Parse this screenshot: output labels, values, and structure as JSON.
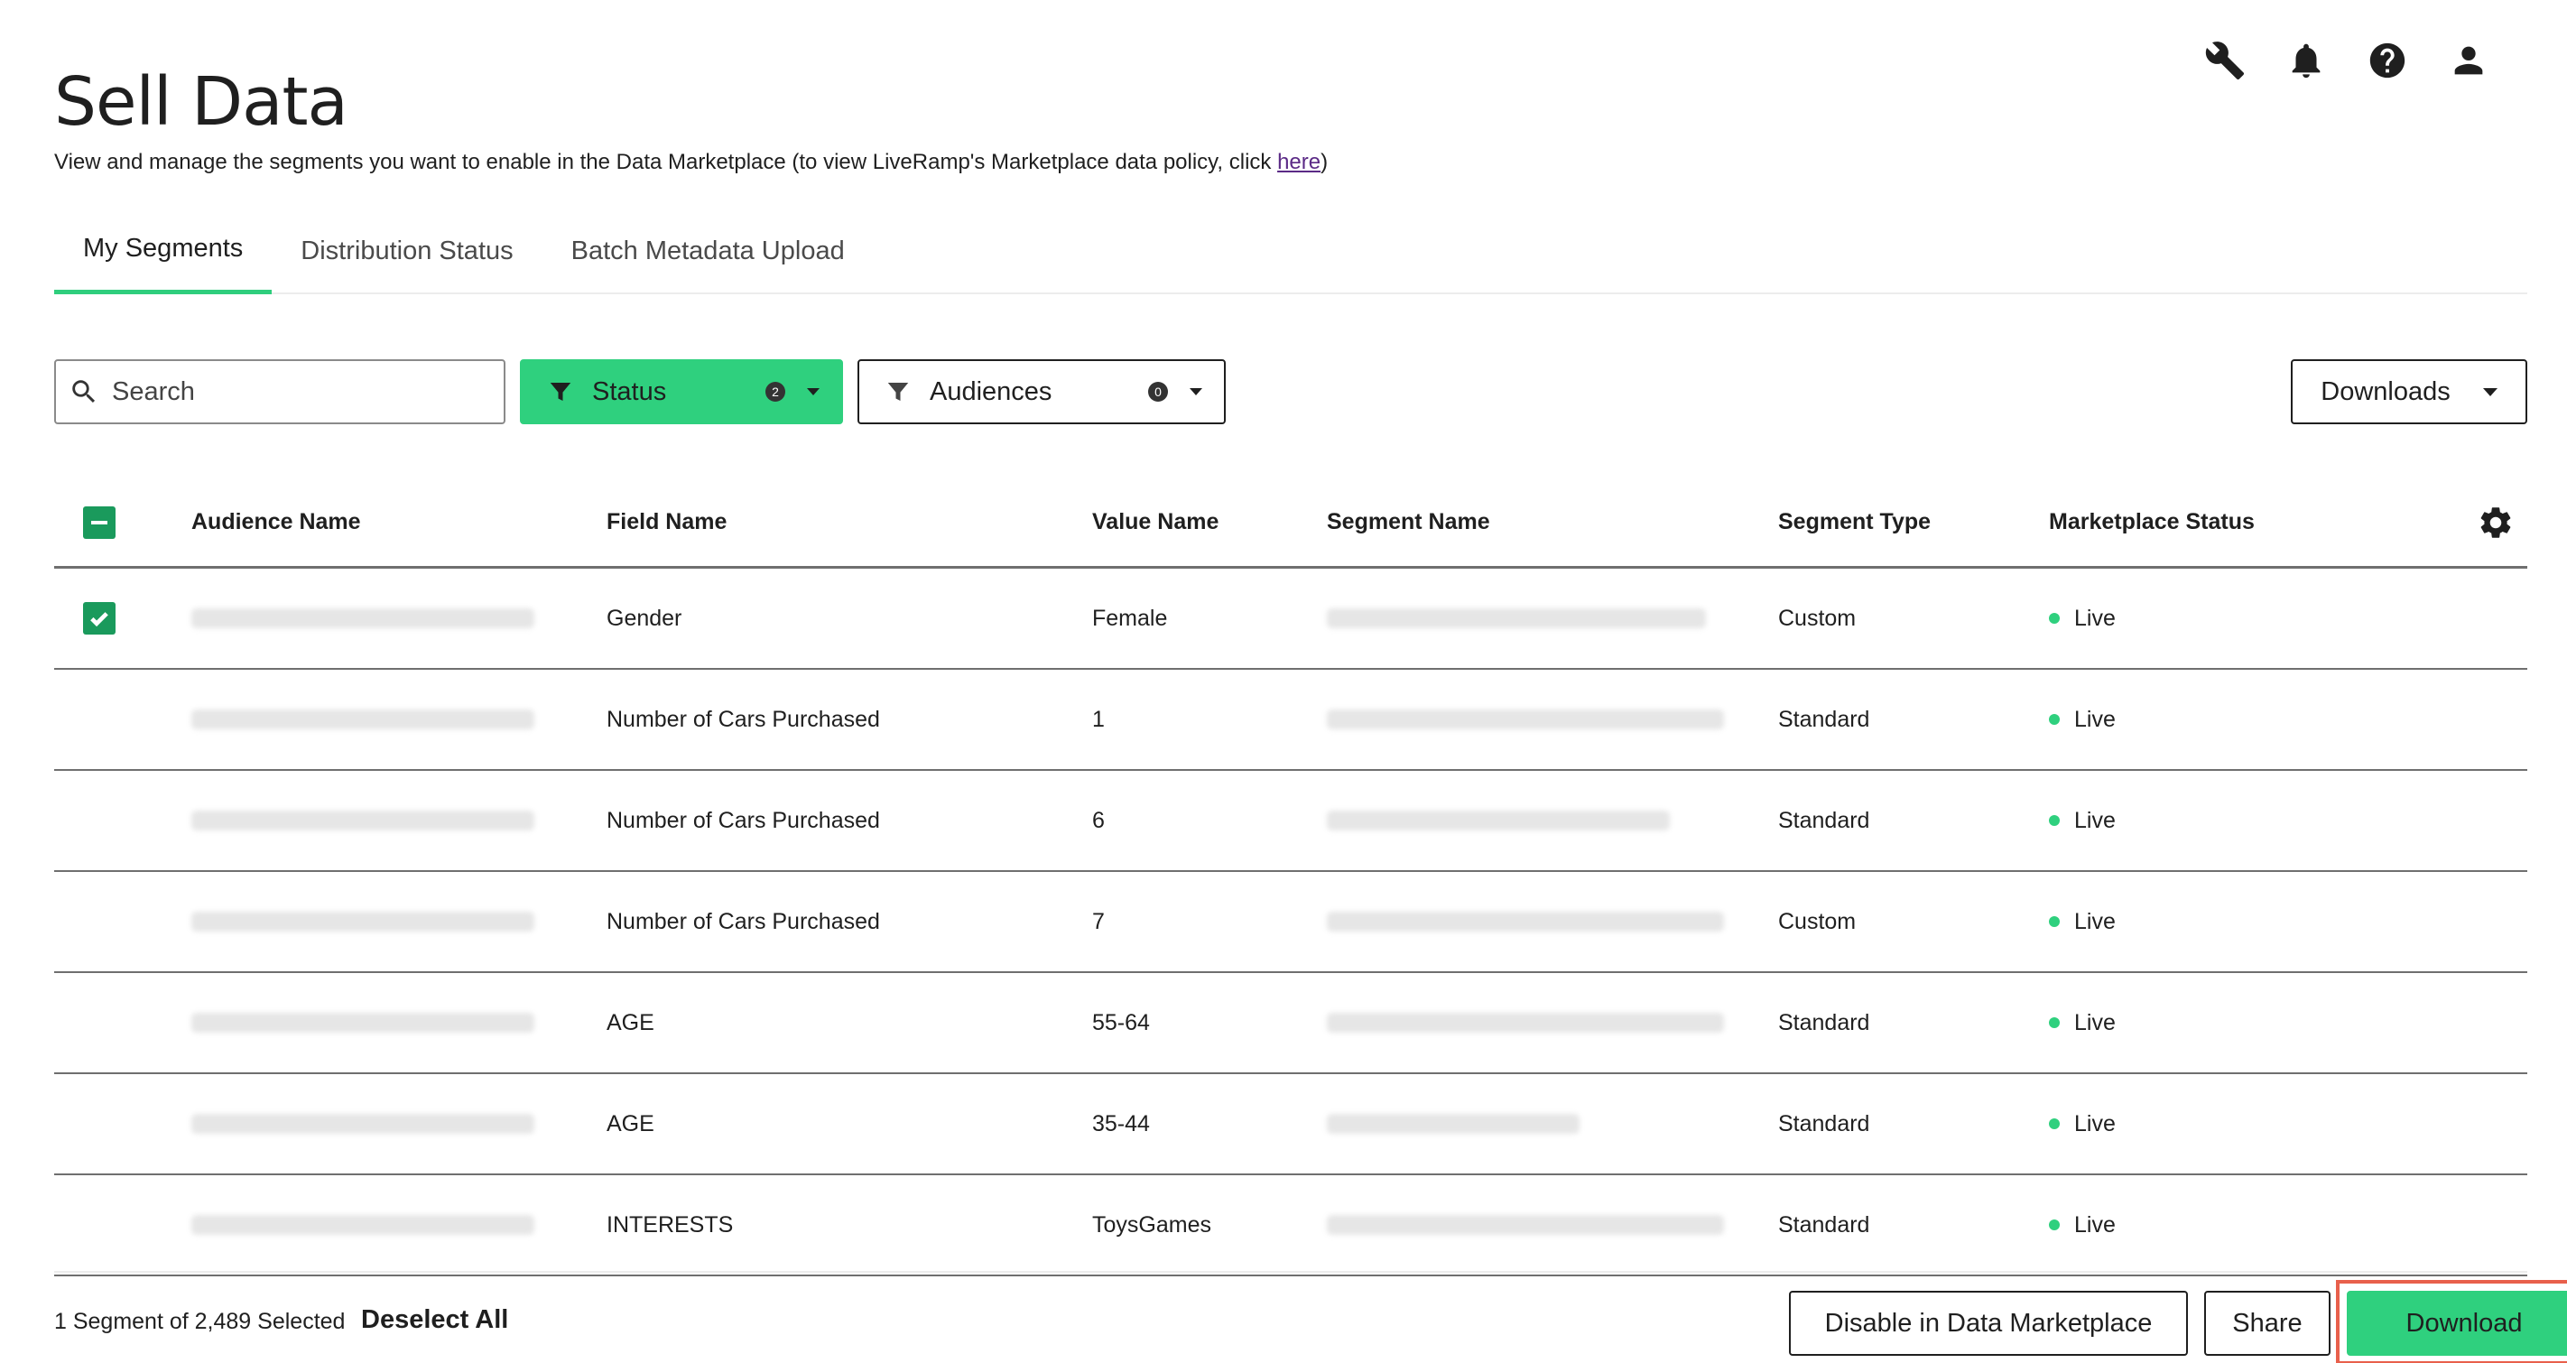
{
  "header": {
    "title": "Sell Data",
    "description": "View and manage the segments you want to enable in the Data Marketplace (to view LiveRamp's Marketplace data policy, click ",
    "link_text": "here",
    "description_end": ")",
    "icons": [
      "wrench-icon",
      "bell-icon",
      "help-icon",
      "user-icon"
    ]
  },
  "tabs": [
    {
      "label": "My Segments",
      "active": true
    },
    {
      "label": "Distribution Status",
      "active": false
    },
    {
      "label": "Batch Metadata Upload",
      "active": false
    }
  ],
  "toolbar": {
    "search_placeholder": "Search",
    "status_filter": {
      "label": "Status",
      "count": "2"
    },
    "audiences_filter": {
      "label": "Audiences",
      "count": "0"
    },
    "downloads_label": "Downloads"
  },
  "table": {
    "columns": [
      "Audience Name",
      "Field Name",
      "Value Name",
      "Segment Name",
      "Segment Type",
      "Marketplace Status"
    ],
    "rows": [
      {
        "checked": true,
        "field": "Gender",
        "value": "Female",
        "type": "Custom",
        "status": "Live"
      },
      {
        "checked": false,
        "field": "Number of Cars Purchased",
        "value": "1",
        "type": "Standard",
        "status": "Live"
      },
      {
        "checked": false,
        "field": "Number of Cars Purchased",
        "value": "6",
        "type": "Standard",
        "status": "Live"
      },
      {
        "checked": false,
        "field": "Number of Cars Purchased",
        "value": "7",
        "type": "Custom",
        "status": "Live"
      },
      {
        "checked": false,
        "field": "AGE",
        "value": "55-64",
        "type": "Standard",
        "status": "Live"
      },
      {
        "checked": false,
        "field": "AGE",
        "value": "35-44",
        "type": "Standard",
        "status": "Live"
      },
      {
        "checked": false,
        "field": "INTERESTS",
        "value": "ToysGames",
        "type": "Standard",
        "status": "Live"
      }
    ]
  },
  "footer": {
    "selection_text": "1 Segment of 2,489 Selected",
    "deselect_label": "Deselect All",
    "disable_label": "Disable in Data Marketplace",
    "share_label": "Share",
    "download_label": "Download"
  },
  "colors": {
    "accent": "#2fd07e",
    "checkbox": "#1a9a5c",
    "highlight": "#e8604c"
  }
}
